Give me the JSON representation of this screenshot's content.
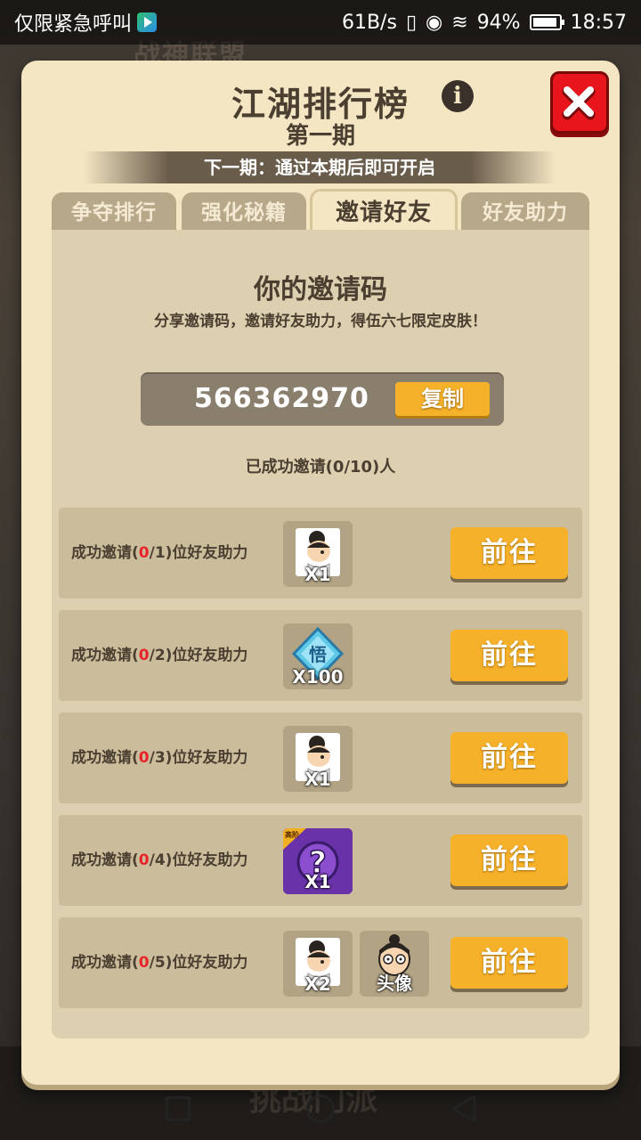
{
  "status_bar": {
    "carrier_text": "仅限紧急呼叫",
    "net_speed": "61B/s",
    "battery": "94%",
    "time": "18:57"
  },
  "background": {
    "title": "战神联盟",
    "bottom_text": "挑战门派"
  },
  "modal": {
    "title": "江湖排行榜",
    "subtitle": "第一期",
    "notice": "下一期：通过本期后即可开启",
    "tabs": [
      {
        "label": "争夺排行",
        "active": false
      },
      {
        "label": "强化秘籍",
        "active": false
      },
      {
        "label": "邀请好友",
        "active": true
      },
      {
        "label": "好友助力",
        "active": false
      }
    ]
  },
  "invite": {
    "title": "你的邀请码",
    "description": "分享邀请码，邀请好友助力，得伍六七限定皮肤！",
    "code": "566362970",
    "copy_label": "复制",
    "success_text": "已成功邀请(0/10)人"
  },
  "tasks": [
    {
      "prefix": "成功邀请(",
      "done": "0",
      "target": "/1)位好友助力",
      "rewards": [
        {
          "icon": "character-icon",
          "qty": "X1"
        }
      ],
      "button": "前往"
    },
    {
      "prefix": "成功邀请(",
      "done": "0",
      "target": "/2)位好友助力",
      "rewards": [
        {
          "icon": "diamond-icon",
          "qty": "X100",
          "glyph": "悟"
        }
      ],
      "button": "前往"
    },
    {
      "prefix": "成功邀请(",
      "done": "0",
      "target": "/3)位好友助力",
      "rewards": [
        {
          "icon": "character-icon",
          "qty": "X1"
        }
      ],
      "button": "前往"
    },
    {
      "prefix": "成功邀请(",
      "done": "0",
      "target": "/4)位好友助力",
      "rewards": [
        {
          "icon": "mystery-box-icon",
          "qty": "X1",
          "badge": "高阶"
        }
      ],
      "button": "前往"
    },
    {
      "prefix": "成功邀请(",
      "done": "0",
      "target": "/5)位好友助力",
      "rewards": [
        {
          "icon": "character-icon",
          "qty": "X2"
        },
        {
          "icon": "avatar-icon",
          "qty": "头像"
        }
      ],
      "button": "前往"
    }
  ],
  "colors": {
    "accent_button": "#f6b12a",
    "close_button": "#e8161c",
    "progress_red": "#e8232a",
    "modal_bg": "#f4e6c3"
  }
}
